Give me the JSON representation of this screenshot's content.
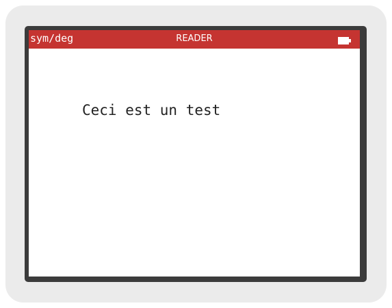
{
  "status_bar": {
    "mode": "sym/deg",
    "title": "READER",
    "battery_icon": "battery-full-icon",
    "color": "#c53431"
  },
  "document": {
    "text": "Ceci est un test"
  }
}
